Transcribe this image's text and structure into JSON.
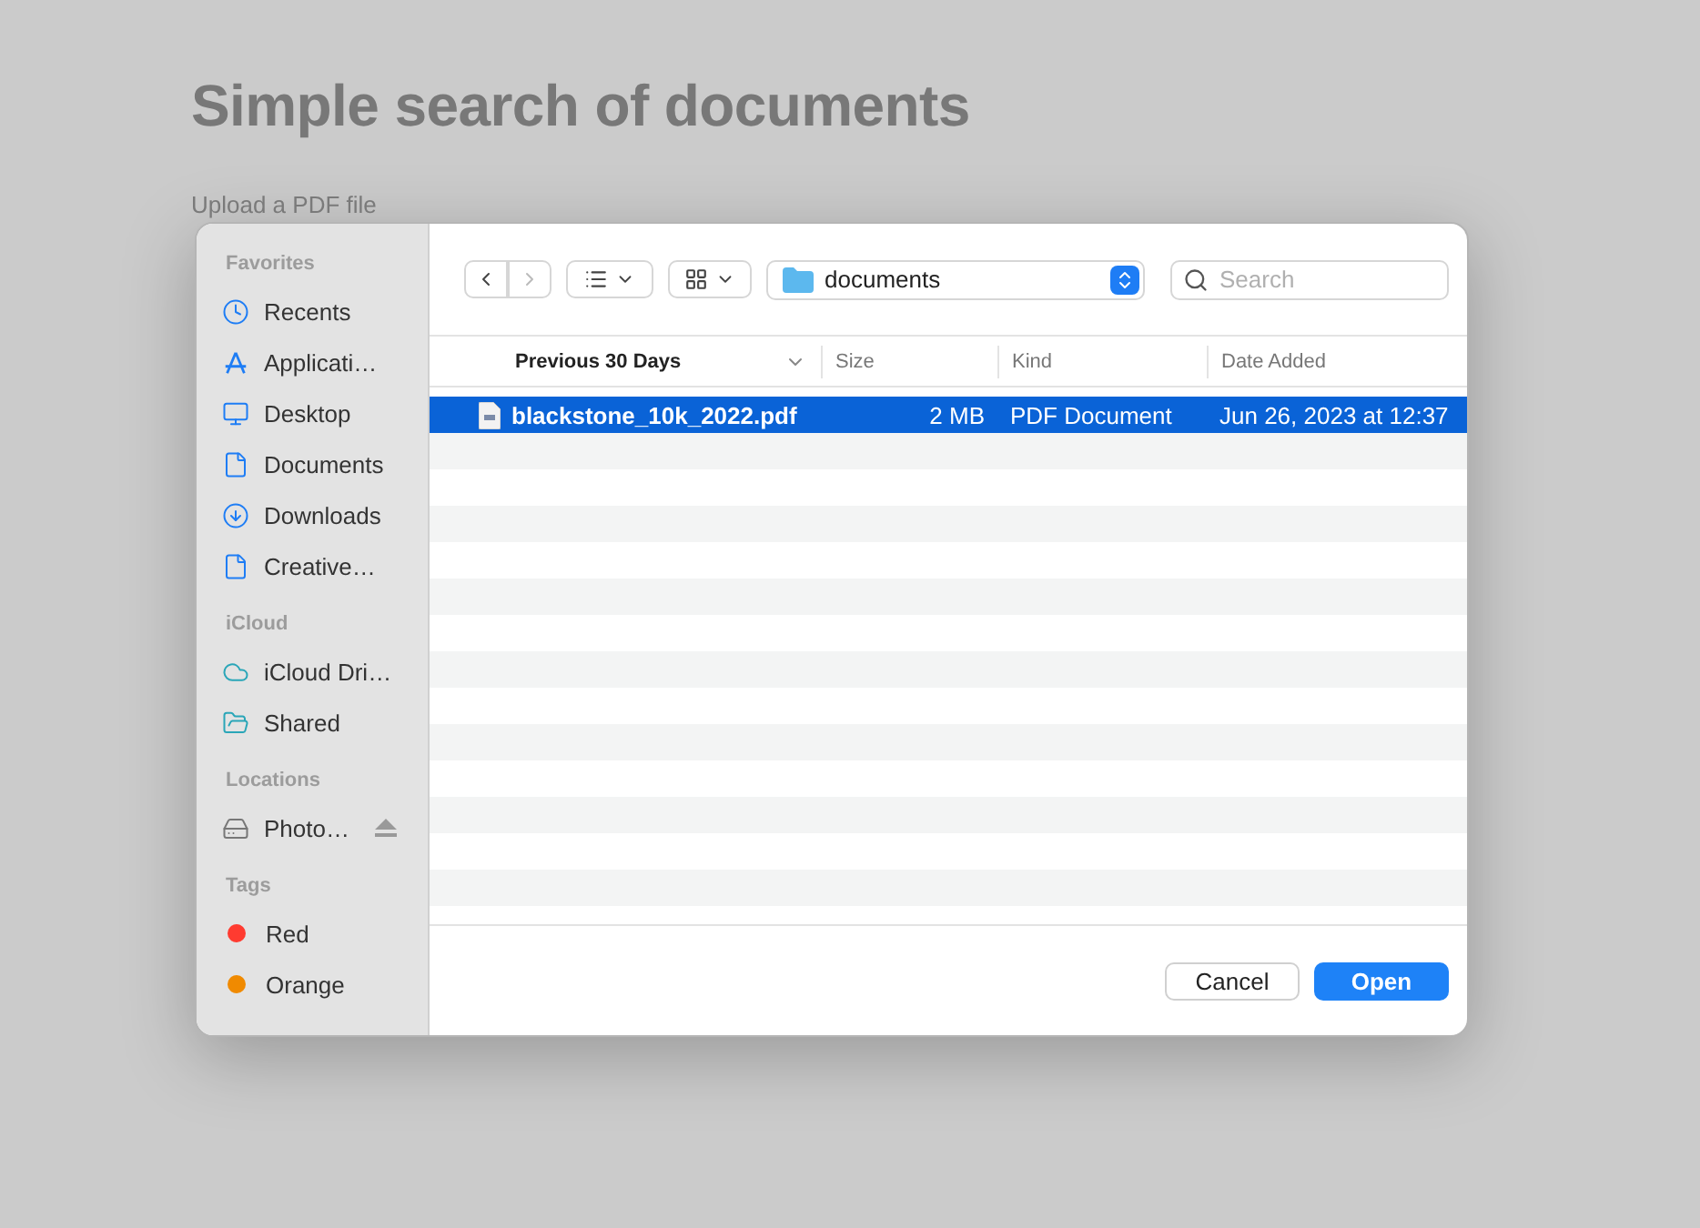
{
  "page": {
    "title": "Simple search of documents",
    "upload_label": "Upload a PDF file"
  },
  "sidebar": {
    "sections": [
      {
        "heading": "Favorites",
        "items": [
          {
            "kind": "recents",
            "label": "Recents"
          },
          {
            "kind": "applications",
            "label": "Applicati…"
          },
          {
            "kind": "desktop",
            "label": "Desktop"
          },
          {
            "kind": "documents",
            "label": "Documents"
          },
          {
            "kind": "downloads",
            "label": "Downloads"
          },
          {
            "kind": "file",
            "label": "Creative…"
          }
        ]
      },
      {
        "heading": "iCloud",
        "items": [
          {
            "kind": "cloud",
            "label": "iCloud Dri…"
          },
          {
            "kind": "shared",
            "label": "Shared"
          }
        ]
      },
      {
        "heading": "Locations",
        "items": [
          {
            "kind": "drive",
            "label": "Photo…"
          }
        ]
      },
      {
        "heading": "Tags",
        "items": [
          {
            "kind": "tag",
            "label": "Red",
            "color": "#ff3b30"
          },
          {
            "kind": "tag",
            "label": "Orange",
            "color": "#f08a00"
          }
        ]
      }
    ]
  },
  "toolbar": {
    "location": "documents",
    "search": {
      "placeholder": "Search"
    }
  },
  "table": {
    "columns": [
      "Previous 30 Days",
      "Size",
      "Kind",
      "Date Added"
    ],
    "rows": [
      {
        "name": "blackstone_10k_2022.pdf",
        "size": "2 MB",
        "kind": "PDF Document",
        "date_added": "Jun 26, 2023 at 12:37",
        "selected": true
      }
    ]
  },
  "buttons": {
    "cancel": "Cancel",
    "open": "Open"
  }
}
